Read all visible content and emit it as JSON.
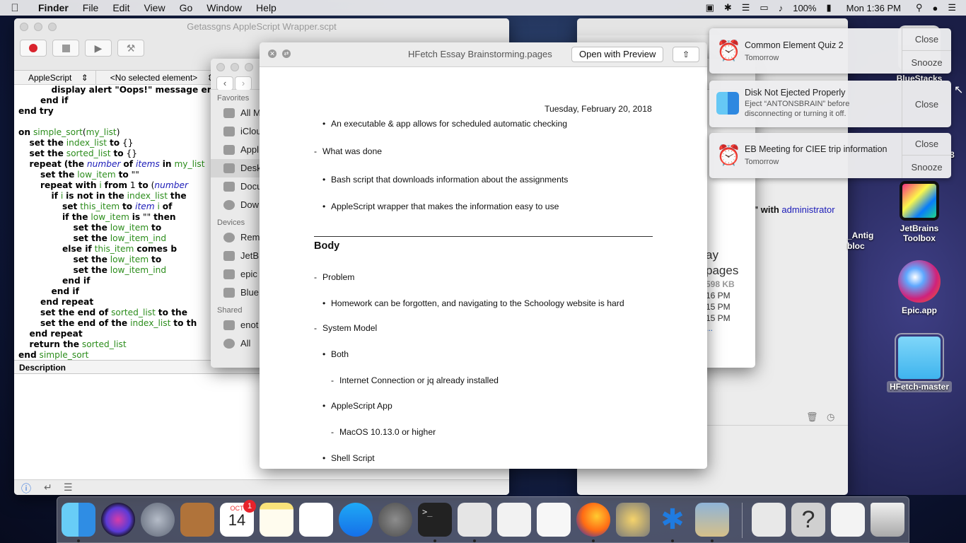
{
  "menubar": {
    "app_name": "Finder",
    "menus": [
      "File",
      "Edit",
      "View",
      "Go",
      "Window",
      "Help"
    ],
    "battery": "100%",
    "clock": "Mon 1:36 PM"
  },
  "script_editor": {
    "title": "Getassgns AppleScript Wrapper.scpt",
    "language": "AppleScript",
    "element_selector": "<No selected element>",
    "description_label": "Description",
    "code": {
      "l1": "display alert \"Oops!\" message err",
      "l2": "end if",
      "l3": "end try",
      "l4a": "on",
      "l4b": "simple_sort",
      "l4c": "(",
      "l4d": "my_list",
      "l4e": ")",
      "l5a": "set the",
      "l5b": "index_list",
      "l5c": "to",
      "l5d": "{}",
      "l6a": "set the",
      "l6b": "sorted_list",
      "l6c": "to",
      "l6d": "{}",
      "l7a": "repeat",
      "l7b": "(the",
      "l7c": "number",
      "l7d": "of",
      "l7e": "items",
      "l7f": "in",
      "l7g": "my_list",
      "l8a": "set the",
      "l8b": "low_item",
      "l8c": "to",
      "l8d": "\"\"",
      "l9a": "repeat with",
      "l9b": "i",
      "l9c": "from",
      "l9d": "1",
      "l9e": "to",
      "l9f": "(",
      "l9g": "number",
      "l10a": "if",
      "l10b": "i",
      "l10c": "is not in the",
      "l10d": "index_list",
      "l10e": "the",
      "l11a": "set",
      "l11b": "this_item",
      "l11c": "to",
      "l11d": "item",
      "l11e": "i",
      "l11f": "of",
      "l12a": "if the",
      "l12b": "low_item",
      "l12c": "is",
      "l12d": "\"\"",
      "l12e": "then",
      "l13a": "set the",
      "l13b": "low_item",
      "l13c": "to",
      "l14a": "set the",
      "l14b": "low_item_ind",
      "l15a": "else if",
      "l15b": "this_item",
      "l15c": "comes b",
      "l16a": "set the",
      "l16b": "low_item",
      "l16c": "to",
      "l17a": "set the",
      "l17b": "low_item_ind",
      "l18": "end if",
      "l19": "end if",
      "l20": "end repeat",
      "l21a": "set the end of",
      "l21b": "sorted_list",
      "l21c": "to the",
      "l22a": "set the end of the",
      "l22b": "index_list",
      "l22c": "to th",
      "l23": "end repeat",
      "l24a": "return the",
      "l24b": "sorted_list",
      "l25a": "end",
      "l25b": "simple_sort"
    }
  },
  "finder": {
    "favorites_header": "Favorites",
    "devices_header": "Devices",
    "shared_header": "Shared",
    "favorites": [
      "All M",
      "iClou",
      "Appl",
      "Desk",
      "Docu",
      "Dow"
    ],
    "devices": [
      "Rem",
      "JetB",
      "epic",
      "Blue"
    ],
    "shared": [
      "enot",
      "All"
    ],
    "preview_name1": "ay",
    "preview_name2": "pages",
    "preview_size": "598 KB",
    "preview_created": "16 PM",
    "preview_modified": "15 PM",
    "preview_opened": "15 PM",
    "preview_more": "..."
  },
  "right_window": {
    "snippet_with": "\" with",
    "snippet_admin": "administrator",
    "sidebar_frag1": "_Antig",
    "sidebar_frag2": "bloc"
  },
  "doc_window": {
    "title": "HFetch Essay Brainstorming.pages",
    "open_button": "Open with Preview",
    "date": "Tuesday, February 20, 2018",
    "lines": {
      "exec": "An executable & app allows for scheduled automatic checking",
      "what_done": "What was done",
      "bash": "Bash script that downloads information about the assignments",
      "applescript_wrapper": "AppleScript wrapper that makes the information easy to use",
      "body": "Body",
      "problem": "Problem",
      "homework": "Homework can be forgotten, and navigating to the Schoology website is hard",
      "system_model": "System Model",
      "both": "Both",
      "internet": "Internet Connection or jq already installed",
      "applescript_app": "AppleScript App",
      "macos": "MacOS 10.13.0 or higher",
      "shell": "Shell Script"
    }
  },
  "notifications": [
    {
      "title": "Common Element Quiz 2",
      "subtitle": "Tomorrow",
      "action1": "Close",
      "action2": "Snooze",
      "icon": "alarm-clock-icon"
    },
    {
      "title": "Disk Not Ejected Properly",
      "subtitle": "Eject “ANTONSBRAIN” before disconnecting or turning it off.",
      "action1": "Close",
      "icon": "finder-icon"
    },
    {
      "title": "EB Meeting for CIEE trip information",
      "subtitle": "Tomorrow",
      "action1": "Close",
      "action2": "Snooze",
      "icon": "alarm-clock-icon"
    }
  ],
  "desktop_icons": {
    "bluestacks": "BlueStacks",
    "jetbrains": "JetBrains Toolbox",
    "epic": "Epic.app",
    "hfetch": "HFetch-master",
    "partial_8": "8"
  },
  "dock": {
    "calendar_month": "OCT",
    "calendar_day": "14",
    "calendar_badge": "1"
  }
}
